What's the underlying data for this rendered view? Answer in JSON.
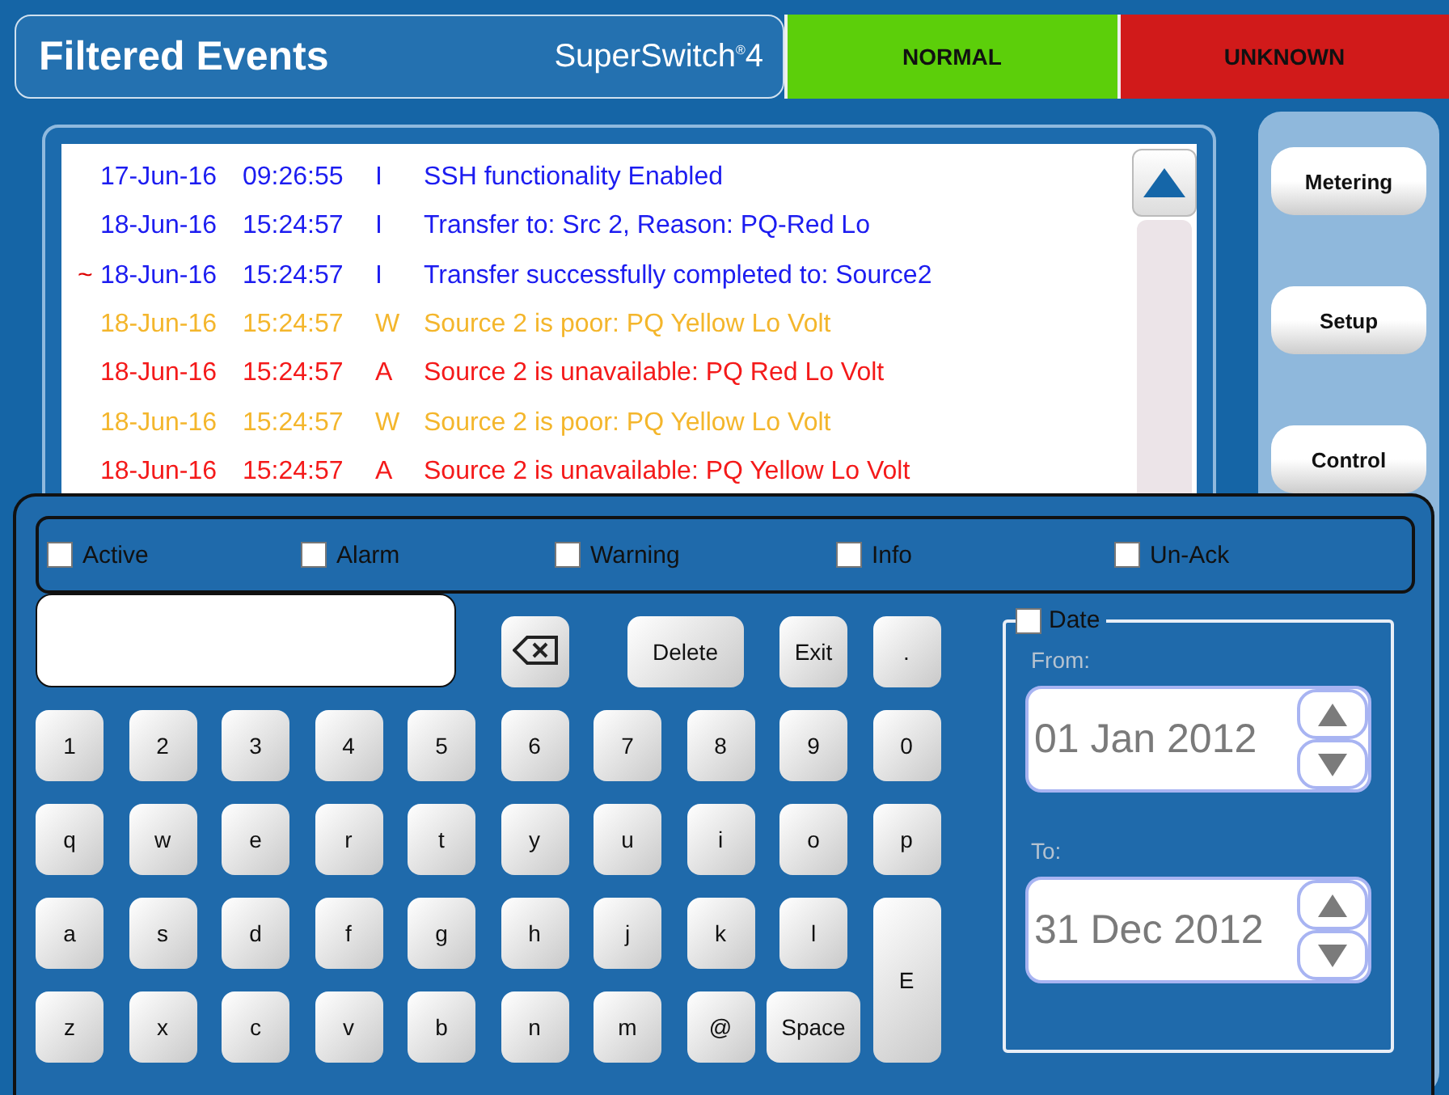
{
  "header": {
    "title": "Filtered Events",
    "brand": "SuperSwitch$^{®}$4"
  },
  "status": [
    {
      "label": "NORMAL",
      "color": "#5ccf0a"
    },
    {
      "label": "UNKNOWN",
      "color": "#d11a1a"
    }
  ],
  "events": [
    {
      "date": "17-Jun-16",
      "time": "09:26:55",
      "type": "I",
      "message": "SSH functionality Enabled",
      "kind": "info"
    },
    {
      "date": "18-Jun-16",
      "time": "15:24:57",
      "type": "I",
      "message": "Transfer to: Src 2, Reason: PQ-Red Lo",
      "kind": "info"
    },
    {
      "marker": "~",
      "date": "18-Jun-16",
      "time": "15:24:57",
      "type": "I",
      "message": "Transfer successfully completed to: Source2",
      "kind": "info"
    },
    {
      "date": "18-Jun-16",
      "time": "15:24:57",
      "type": "W",
      "message": "Source 2 is poor: PQ Yellow Lo Volt",
      "kind": "warning"
    },
    {
      "date": "18-Jun-16",
      "time": "15:24:57",
      "type": "A",
      "message": "Source 2 is unavailable: PQ Red Lo Volt",
      "kind": "alarm"
    },
    {
      "date": "18-Jun-16",
      "time": "15:24:57",
      "type": "W",
      "message": "Source 2 is poor: PQ Yellow Lo Volt",
      "kind": "warning"
    },
    {
      "date": "18-Jun-16",
      "time": "15:24:57",
      "type": "A",
      "message": "Source 2 is unavailable: PQ Yellow Lo Volt",
      "kind": "alarm"
    }
  ],
  "sidebar": [
    {
      "label": "Metering"
    },
    {
      "label": "Setup"
    },
    {
      "label": "Control"
    }
  ],
  "filters": [
    {
      "label": "Active",
      "checked": false
    },
    {
      "label": "Alarm",
      "checked": false
    },
    {
      "label": "Warning",
      "checked": false
    },
    {
      "label": "Info",
      "checked": false
    },
    {
      "label": "Un-Ack",
      "checked": false
    }
  ],
  "edit_keys": [
    {
      "kind": "backspace"
    },
    {
      "kind": "wide",
      "label": "Delete"
    },
    {
      "kind": "key",
      "label": "Exit"
    },
    {
      "kind": "key",
      "label": "."
    }
  ],
  "keys": [
    {
      "kind": "key",
      "label": "1"
    },
    {
      "kind": "key",
      "label": "2"
    },
    {
      "kind": "key",
      "label": "3"
    },
    {
      "kind": "key",
      "label": "4"
    },
    {
      "kind": "key",
      "label": "5"
    },
    {
      "kind": "key",
      "label": "6"
    },
    {
      "kind": "key",
      "label": "7"
    },
    {
      "kind": "key",
      "label": "8"
    },
    {
      "kind": "key",
      "label": "9"
    },
    {
      "kind": "key",
      "label": "0"
    },
    {
      "kind": "key",
      "label": "q"
    },
    {
      "kind": "key",
      "label": "w"
    },
    {
      "kind": "key",
      "label": "e"
    },
    {
      "kind": "key",
      "label": "r"
    },
    {
      "kind": "key",
      "label": "t"
    },
    {
      "kind": "key",
      "label": "y"
    },
    {
      "kind": "key",
      "label": "u"
    },
    {
      "kind": "key",
      "label": "i"
    },
    {
      "kind": "key",
      "label": "o"
    },
    {
      "kind": "key",
      "label": "p"
    },
    {
      "kind": "key",
      "label": "a"
    },
    {
      "kind": "key",
      "label": "s"
    },
    {
      "kind": "key",
      "label": "d"
    },
    {
      "kind": "key",
      "label": "f"
    },
    {
      "kind": "key",
      "label": "g"
    },
    {
      "kind": "key",
      "label": "h"
    },
    {
      "kind": "key",
      "label": "j"
    },
    {
      "kind": "key",
      "label": "k"
    },
    {
      "kind": "key",
      "label": "l"
    },
    {
      "kind": "tall",
      "label": "E"
    },
    {
      "kind": "key",
      "label": "z"
    },
    {
      "kind": "key",
      "label": "x"
    },
    {
      "kind": "key",
      "label": "c"
    },
    {
      "kind": "key",
      "label": "v"
    },
    {
      "kind": "key",
      "label": "b"
    },
    {
      "kind": "key",
      "label": "n"
    },
    {
      "kind": "key",
      "label": "m"
    },
    {
      "kind": "key",
      "label": "@"
    },
    {
      "kind": "key",
      "label": "Space"
    }
  ],
  "date_filter": {
    "label": "Date",
    "checked": false,
    "from_label": "From:",
    "from": "01 Jan 2012",
    "to_label": "To:",
    "to": "31 Dec 2012"
  }
}
